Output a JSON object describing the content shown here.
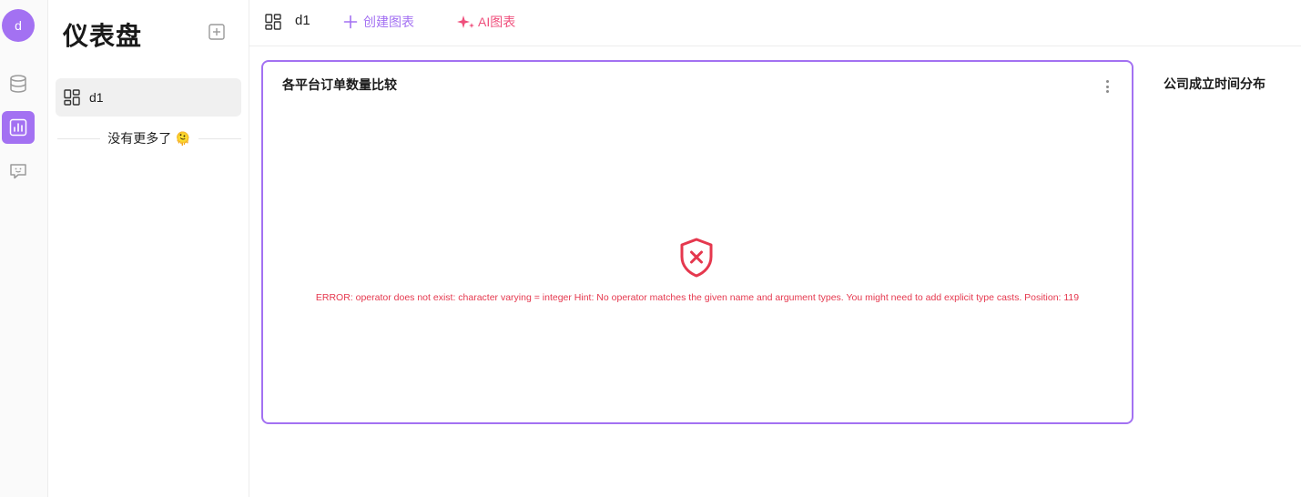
{
  "user": {
    "avatar_initial": "d"
  },
  "rail": {
    "items": [
      {
        "name": "database",
        "active": false
      },
      {
        "name": "dashboard",
        "active": true
      },
      {
        "name": "chat",
        "active": false
      }
    ],
    "accent_color": "#a371f2"
  },
  "panel": {
    "title": "仪表盘",
    "items": [
      {
        "label": "d1"
      }
    ],
    "no_more_text": "没有更多了",
    "no_more_emoji": "🫠"
  },
  "toolbar": {
    "dashboard_name": "d1",
    "create_chart_label": "创建图表",
    "ai_chart_label": "AI图表"
  },
  "cards": [
    {
      "title": "各平台订单数量比较",
      "error_message": "ERROR: operator does not exist: character varying = integer Hint: No operator matches the given name and argument types. You might need to add explicit type casts. Position: 119",
      "error_color": "#e5384e"
    },
    {
      "title": "公司成立时间分布"
    }
  ]
}
